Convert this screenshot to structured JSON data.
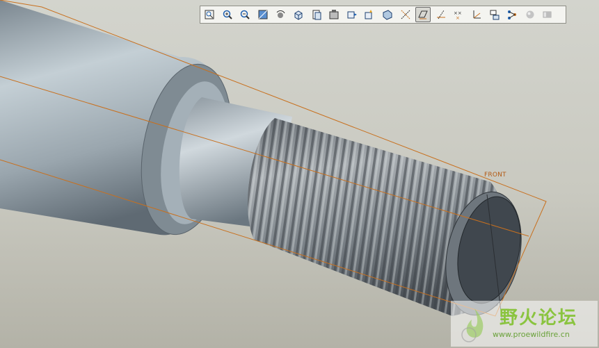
{
  "toolbar": {
    "items": [
      {
        "name": "refit-icon",
        "label": "Refit",
        "active": false
      },
      {
        "name": "zoom-in-icon",
        "label": "Zoom In",
        "active": false
      },
      {
        "name": "zoom-out-icon",
        "label": "Zoom Out",
        "active": false
      },
      {
        "name": "repaint-icon",
        "label": "Repaint",
        "active": false
      },
      {
        "name": "spin-center-icon",
        "label": "Spin Center",
        "active": false
      },
      {
        "name": "orient-mode-icon",
        "label": "Orient Mode",
        "active": false
      },
      {
        "name": "saved-views-icon",
        "label": "Saved Views",
        "active": false
      },
      {
        "name": "display-style-icon",
        "label": "Display Style",
        "active": false
      },
      {
        "name": "view-manager-icon",
        "label": "View Manager",
        "active": false
      },
      {
        "name": "layers-icon",
        "label": "Layers",
        "active": false
      },
      {
        "name": "perspective-icon",
        "label": "Perspective",
        "active": false
      },
      {
        "name": "datum-axes-icon",
        "label": "Datum Axes",
        "active": false
      },
      {
        "name": "datum-planes-icon",
        "label": "Datum Planes",
        "active": true
      },
      {
        "name": "datum-axis-display-icon",
        "label": "Axis Display",
        "active": false
      },
      {
        "name": "datum-points-icon",
        "label": "Datum Points",
        "active": false
      },
      {
        "name": "coordinate-systems-icon",
        "label": "Coordinate Systems",
        "active": false
      },
      {
        "name": "annotations-icon",
        "label": "Annotations",
        "active": false
      },
      {
        "name": "network-icon",
        "label": "Network",
        "active": false
      },
      {
        "name": "sphere-icon",
        "label": "Appearance",
        "active": false
      },
      {
        "name": "shade-icon",
        "label": "Shading",
        "active": false
      }
    ]
  },
  "model": {
    "datum_plane_label": "FRONT"
  },
  "watermark": {
    "title": "野火论坛",
    "url": "www.proewildfire.cn"
  },
  "colors": {
    "datum_line": "#c8701e",
    "shaft_light": "#c2ccd2",
    "shaft_dark": "#6d7780",
    "end_face": "#40474e",
    "thread_light": "#b9bdc1",
    "thread_dark": "#3c4248"
  }
}
